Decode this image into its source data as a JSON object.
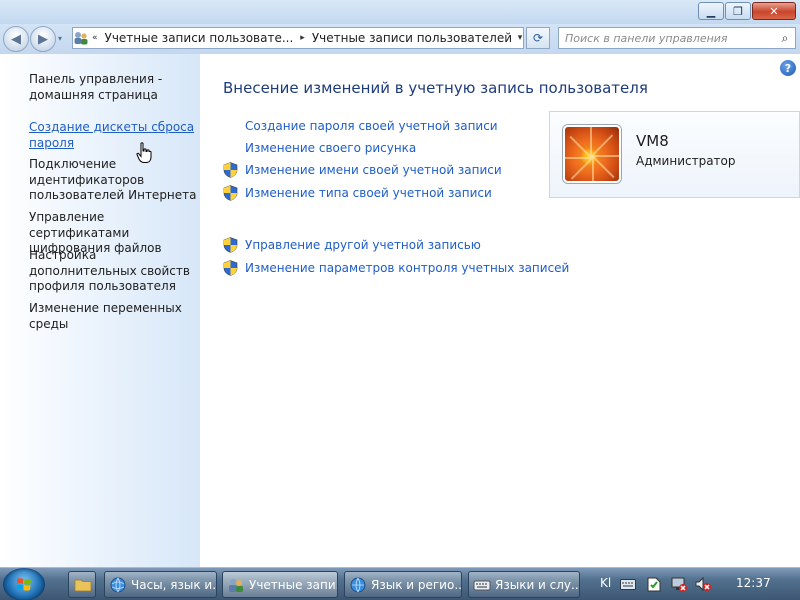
{
  "window": {
    "minimize_glyph": "▁",
    "maximize_glyph": "❐",
    "close_glyph": "✕"
  },
  "addressbar": {
    "back_glyph": "◀",
    "forward_glyph": "▶",
    "history_glyph": "▾",
    "overflow_glyph": "«",
    "crumbs": [
      "Учетные записи пользовате...",
      "Учетные записи пользователей"
    ],
    "separator_glyph": "▸",
    "dropdown_glyph": "▾",
    "refresh_glyph": "⟳",
    "search_placeholder": "Поиск в панели управления",
    "search_glyph": "⌕"
  },
  "sidebar": {
    "items": [
      {
        "label": "Панель управления - домашняя страница",
        "link": false
      },
      {
        "label": "Создание дискеты сброса пароля",
        "link": true
      },
      {
        "label": "Подключение идентификаторов пользователей Интернета",
        "link": false
      },
      {
        "label": "Управление сертификатами шифрования файлов",
        "link": false
      },
      {
        "label": "Настройка дополнительных свойств профиля пользователя",
        "link": false
      },
      {
        "label": "Изменение переменных среды",
        "link": false
      }
    ]
  },
  "main": {
    "help_glyph": "?",
    "heading": "Внесение изменений в учетную запись пользователя",
    "tasks": [
      {
        "label": "Создание пароля своей учетной записи",
        "shield": false
      },
      {
        "label": "Изменение своего рисунка",
        "shield": false
      },
      {
        "label": "Изменение имени своей учетной записи",
        "shield": true
      },
      {
        "label": "Изменение типа своей учетной записи",
        "shield": true
      },
      {
        "label": "Управление другой учетной записью",
        "shield": true
      },
      {
        "label": "Изменение параметров контроля учетных записей",
        "shield": true
      }
    ],
    "user": {
      "name": "VM8",
      "role": "Администратор"
    }
  },
  "taskbar": {
    "buttons": [
      {
        "label": "Часы, язык и...",
        "icon": "clock-globe-icon"
      },
      {
        "label": "Учетные запи...",
        "icon": "users-icon",
        "active": true
      },
      {
        "label": "Язык и регио...",
        "icon": "globe-icon"
      },
      {
        "label": "Языки и слу...",
        "icon": "keyboard-icon"
      }
    ],
    "language": "Kl",
    "clock": "12:37"
  },
  "colors": {
    "link": "#1f5ec7",
    "heading": "#1e3c7a",
    "taskbar": "#3c5673"
  }
}
